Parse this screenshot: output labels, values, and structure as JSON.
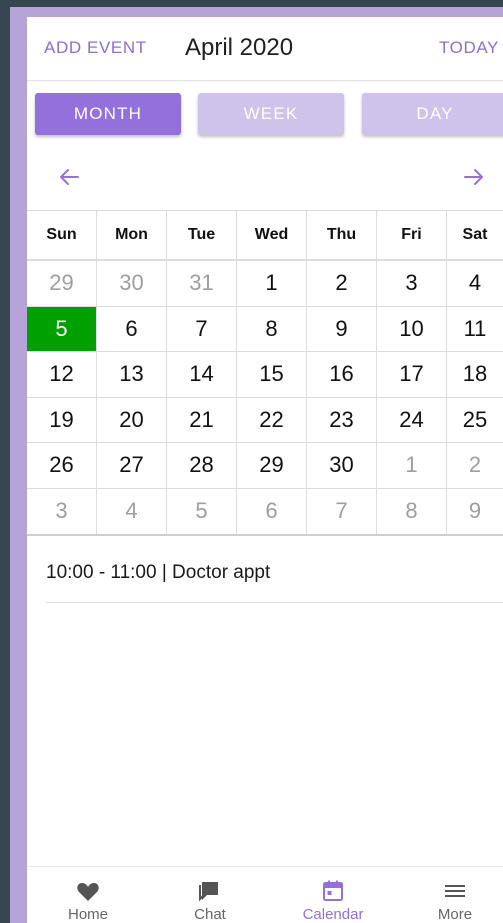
{
  "header": {
    "add_event_label": "ADD EVENT",
    "title": "April 2020",
    "today_label": "TODAY"
  },
  "views": {
    "month_label": "MONTH",
    "week_label": "WEEK",
    "day_label": "DAY",
    "selected": "MONTH"
  },
  "navigation": {
    "prev_icon": "arrow-left-icon",
    "next_icon": "arrow-right-icon"
  },
  "calendar": {
    "weekdays": [
      "Sun",
      "Mon",
      "Tue",
      "Wed",
      "Thu",
      "Fri",
      "Sat"
    ],
    "weeks": [
      [
        "29",
        "30",
        "31",
        "1",
        "2",
        "3",
        "4"
      ],
      [
        "5",
        "6",
        "7",
        "8",
        "9",
        "10",
        "11"
      ],
      [
        "12",
        "13",
        "14",
        "15",
        "16",
        "17",
        "18"
      ],
      [
        "19",
        "20",
        "21",
        "22",
        "23",
        "24",
        "25"
      ],
      [
        "26",
        "27",
        "28",
        "29",
        "30",
        "1",
        "2"
      ],
      [
        "3",
        "4",
        "5",
        "6",
        "7",
        "8",
        "9"
      ]
    ],
    "selected_day": "5",
    "selected_color": "#00a000",
    "accent_color": "#9370db"
  },
  "events": [
    {
      "text": "10:00 - 11:00  | Doctor appt"
    }
  ],
  "bottom_nav": {
    "home_label": "Home",
    "chat_label": "Chat",
    "calendar_label": "Calendar",
    "more_label": "More",
    "active": "Calendar"
  }
}
